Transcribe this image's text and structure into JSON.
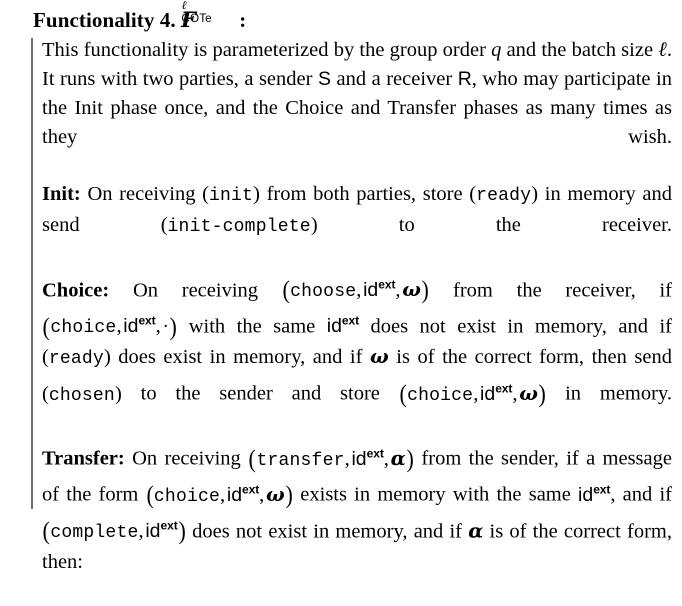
{
  "document": {
    "type": "cryptographic-functionality-box",
    "title": {
      "label": "Functionality 4.",
      "symbol_base": "F",
      "symbol_superscript": "ℓ",
      "symbol_subscript": "COTe",
      "colon": ":"
    },
    "paragraphs": [
      {
        "id": "intro",
        "label": "",
        "text": "This functionality is parameterized by the group order q and the batch size ℓ. It runs with two parties, a sender S and a receiver R, who may participate in the Init phase once, and the Choice and Transfer phases as many times as they wish."
      },
      {
        "id": "init",
        "label": "Init:",
        "text": "On receiving (init) from both parties, store (ready) in memory and send (init-complete) to the receiver."
      },
      {
        "id": "choice",
        "label": "Choice:",
        "text": "On receiving (choose, id^ext, ω) from the receiver, if (choice, id^ext, ·) with the same id^ext does not exist in memory, and if (ready) does exist in memory, and if ω is of the correct form, then send (chosen) to the sender and store (choice, id^ext, ω) in memory."
      },
      {
        "id": "transfer",
        "label": "Transfer:",
        "text": "On receiving (transfer, id^ext, α) from the sender, if a message of the form (choice, id^ext, ω) exists in memory with the same id^ext, and if (complete, id^ext) does not exist in memory, and if α is of the correct form, then:"
      }
    ],
    "tokens": {
      "init": "init",
      "ready": "ready",
      "init_complete": "init-complete",
      "choose": "choose",
      "choice": "choice",
      "chosen": "chosen",
      "transfer": "transfer",
      "complete": "complete"
    },
    "symbols": {
      "q": "q",
      "ell": "ℓ",
      "sender": "S",
      "receiver": "R",
      "id": "id",
      "ext": "ext",
      "omega": "ω",
      "alpha": "α",
      "cdot": "·"
    },
    "phrases": {
      "intro_a": "This functionality is parameterized by the group order ",
      "intro_b": " and the batch size ",
      "intro_c": ". It runs with two parties, a sender ",
      "intro_d": " and a receiver ",
      "intro_e": ", who may participate in the Init phase once, and the Choice and Transfer phases as many times as they wish.",
      "init_a": "On receiving ",
      "init_b": " from both parties, store ",
      "init_c": " in memory and send ",
      "init_d": " to the receiver.",
      "choice_a": "On receiving ",
      "choice_b": " from the receiver, if ",
      "choice_c": " with the same ",
      "choice_d": " does not exist in memory, and if ",
      "choice_e": " does exist in memory, and if ",
      "choice_f": " is of the correct form, then send ",
      "choice_g": " to the sender and store ",
      "choice_h": " in memory.",
      "transfer_a": "On receiving ",
      "transfer_b": " from the sender, if a message of the form ",
      "transfer_c": " exists in memory with the same ",
      "transfer_d": ", and if ",
      "transfer_e": " does not exist in memory, and if ",
      "transfer_f": " is of the correct form, then:"
    },
    "style": {
      "rule_color": "#6f6f6f",
      "text_color": "#000000",
      "background": "#ffffff"
    }
  }
}
